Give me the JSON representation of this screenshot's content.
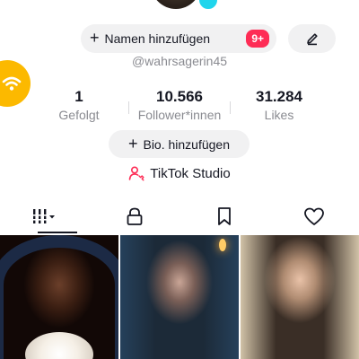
{
  "profile": {
    "handle": "@wahrsagerin45",
    "name_button_label": "Namen hinzufügen",
    "notification_badge": "9+",
    "bio_button_label": "Bio. hinzufügen",
    "studio_label": "TikTok Studio"
  },
  "stats": [
    {
      "value": "1",
      "label": "Gefolgt"
    },
    {
      "value": "10.566",
      "label": "Follower*innen"
    },
    {
      "value": "31.284",
      "label": "Likes"
    }
  ],
  "tabs": [
    {
      "icon": "grid-icon",
      "active": true
    },
    {
      "icon": "lock-icon",
      "active": false
    },
    {
      "icon": "bookmark-icon",
      "active": false
    },
    {
      "icon": "heart-icon",
      "active": false
    }
  ],
  "videos": [
    {
      "icon": "video-thumbnail"
    },
    {
      "icon": "video-thumbnail"
    },
    {
      "icon": "video-thumbnail"
    }
  ],
  "colors": {
    "accent": "#fe2c55",
    "text": "#161823",
    "muted": "#8a8b91",
    "pill": "#f1f1f2",
    "wifi_bubble": "#fcb900"
  }
}
